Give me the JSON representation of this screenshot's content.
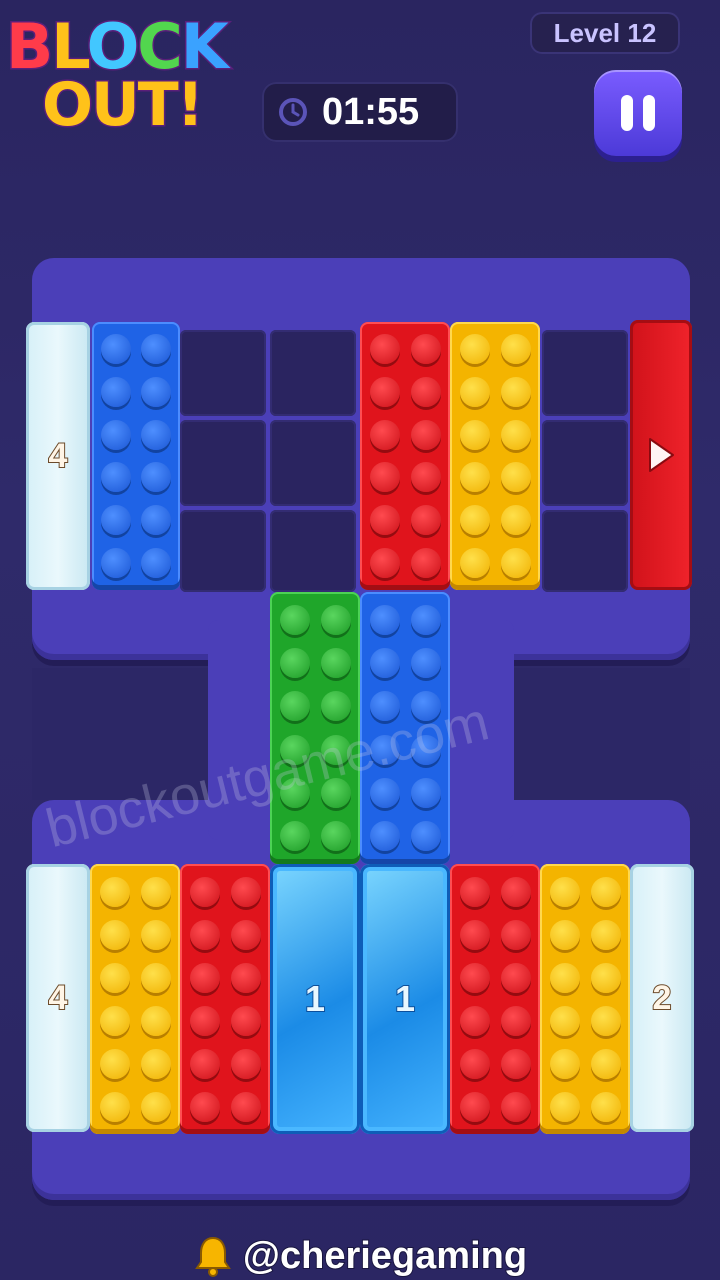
{
  "header": {
    "logo_line1": [
      "B",
      "L",
      "O",
      "C",
      "K"
    ],
    "logo_line2": "OUT!",
    "level_label": "Level 12",
    "timer": "01:55",
    "timer_icon": "clock-icon",
    "pause_icon": "pause-icon"
  },
  "gates": {
    "top_left": "4",
    "bottom_left": "4",
    "bottom_right": "2",
    "top_right_icon": "play-arrow-icon"
  },
  "gems": {
    "left": "1",
    "right": "1"
  },
  "blocks": {
    "top_row": [
      "blue",
      "red",
      "yellow"
    ],
    "middle": [
      "green",
      "blue"
    ],
    "bottom_row": [
      "yellow",
      "red",
      "blue-gem",
      "blue-gem",
      "red",
      "yellow"
    ]
  },
  "colors": {
    "background": "#2b2663",
    "frame": "#4b3fb8",
    "blue": "#1f63e6",
    "red": "#e0141c",
    "yellow": "#f4b400",
    "green": "#1fa62a",
    "gem": "#1b8be6"
  },
  "watermark": "blockoutgame.com",
  "footer": {
    "handle": "@cheriegaming",
    "icon": "bell-icon"
  }
}
